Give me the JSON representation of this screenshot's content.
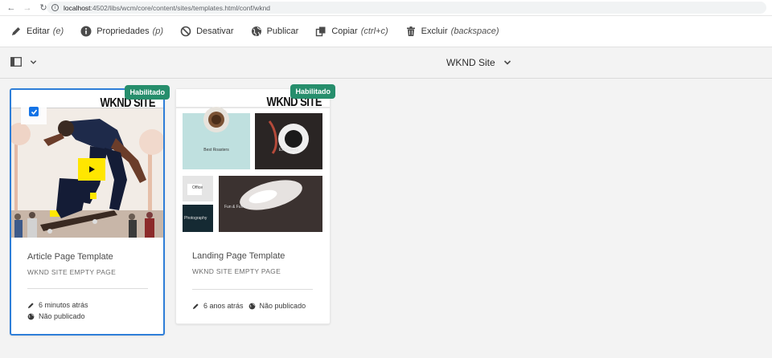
{
  "browser": {
    "url_host": "localhost",
    "url_rest": ":4502/libs/wcm/core/content/sites/templates.html/conf/wknd"
  },
  "actions": [
    {
      "label": "Editar",
      "shortcut": "(e)",
      "icon": "pencil-icon"
    },
    {
      "label": "Propriedades",
      "shortcut": "(p)",
      "icon": "info-icon"
    },
    {
      "label": "Desativar",
      "shortcut": "",
      "icon": "disable-icon"
    },
    {
      "label": "Publicar",
      "shortcut": "",
      "icon": "globe-icon"
    },
    {
      "label": "Copiar",
      "shortcut": "(ctrl+c)",
      "icon": "copy-icon"
    },
    {
      "label": "Excluir",
      "shortcut": "(backspace)",
      "icon": "trash-icon"
    }
  ],
  "header": {
    "site_title": "WKND Site"
  },
  "cards": [
    {
      "badge": "Habilitado",
      "brand": "WKND SITE",
      "title": "Article Page Template",
      "subtitle": "WKND SITE EMPTY PAGE",
      "modified": "6 minutos atrás",
      "publish_status": "Não publicado",
      "selected": true
    },
    {
      "badge": "Habilitado",
      "brand": "WKND SITE",
      "title": "Landing Page Template",
      "subtitle": "WKND SITE EMPTY PAGE",
      "modified": "6 anos atrás",
      "publish_status": "Não publicado",
      "selected": false,
      "tiles": {
        "roasters": "Best Roasters",
        "gallery": "Ext Gallery",
        "office": "Office",
        "photography": "Photography",
        "fun": "Fun & Furious"
      }
    }
  ],
  "colors": {
    "accent": "#2e7ed8",
    "badge": "#268e6c",
    "play": "#ffe600"
  }
}
